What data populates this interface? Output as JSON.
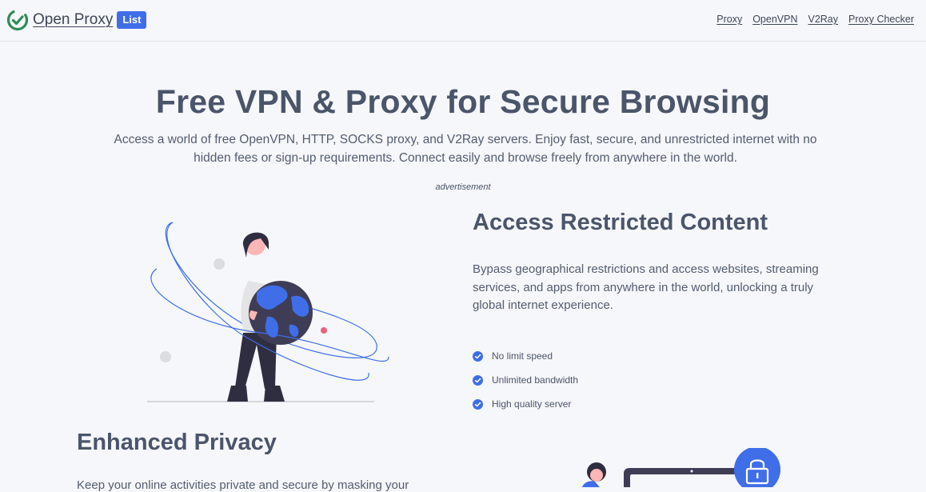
{
  "header": {
    "brand": "Open Proxy",
    "badge": "List",
    "nav": [
      "Proxy",
      "OpenVPN",
      "V2Ray",
      "Proxy Checker"
    ]
  },
  "hero": {
    "title": "Free VPN & Proxy for Secure Browsing",
    "subtitle": "Access a world of free OpenVPN, HTTP, SOCKS proxy, and V2Ray servers. Enjoy fast, secure, and unrestricted internet with no hidden fees or sign-up requirements. Connect easily and browse freely from anywhere in the world.",
    "advertisement": "advertisement"
  },
  "feature1": {
    "title": "Access Restricted Content",
    "description": "Bypass geographical restrictions and access websites, streaming services, and apps from anywhere in the world, unlocking a truly global internet experience.",
    "checks": [
      "No limit speed",
      "Unlimited bandwidth",
      "High quality server"
    ]
  },
  "feature2": {
    "title": "Enhanced Privacy",
    "description": "Keep your online activities private and secure by masking your"
  },
  "colors": {
    "accent": "#3f6ee8",
    "logo_green": "#2e8b57",
    "text": "#4b556a",
    "background": "#f6f7fa"
  }
}
